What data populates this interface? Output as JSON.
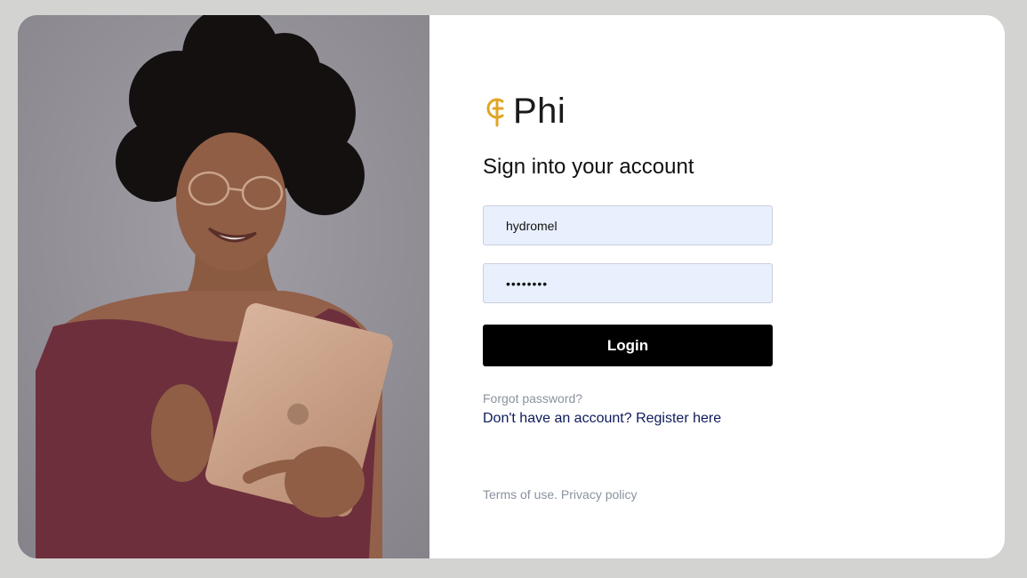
{
  "brand": {
    "name": "Phi",
    "logo_icon": "phi-logo-icon",
    "logo_color": "#e0a526"
  },
  "login": {
    "heading": "Sign into your account",
    "username_value": "hydromel",
    "password_value": "••••••••",
    "login_label": "Login",
    "forgot_label": "Forgot password?",
    "register_label": "Don't have an account? Register here"
  },
  "footer": {
    "terms_label": "Terms of use.",
    "privacy_label": "Privacy policy"
  },
  "colors": {
    "page_background": "#d3d3d1",
    "field_background": "#e8f0fe",
    "button_background": "#000000",
    "link_color": "#0d1a5a",
    "muted_text": "#8a929e"
  }
}
